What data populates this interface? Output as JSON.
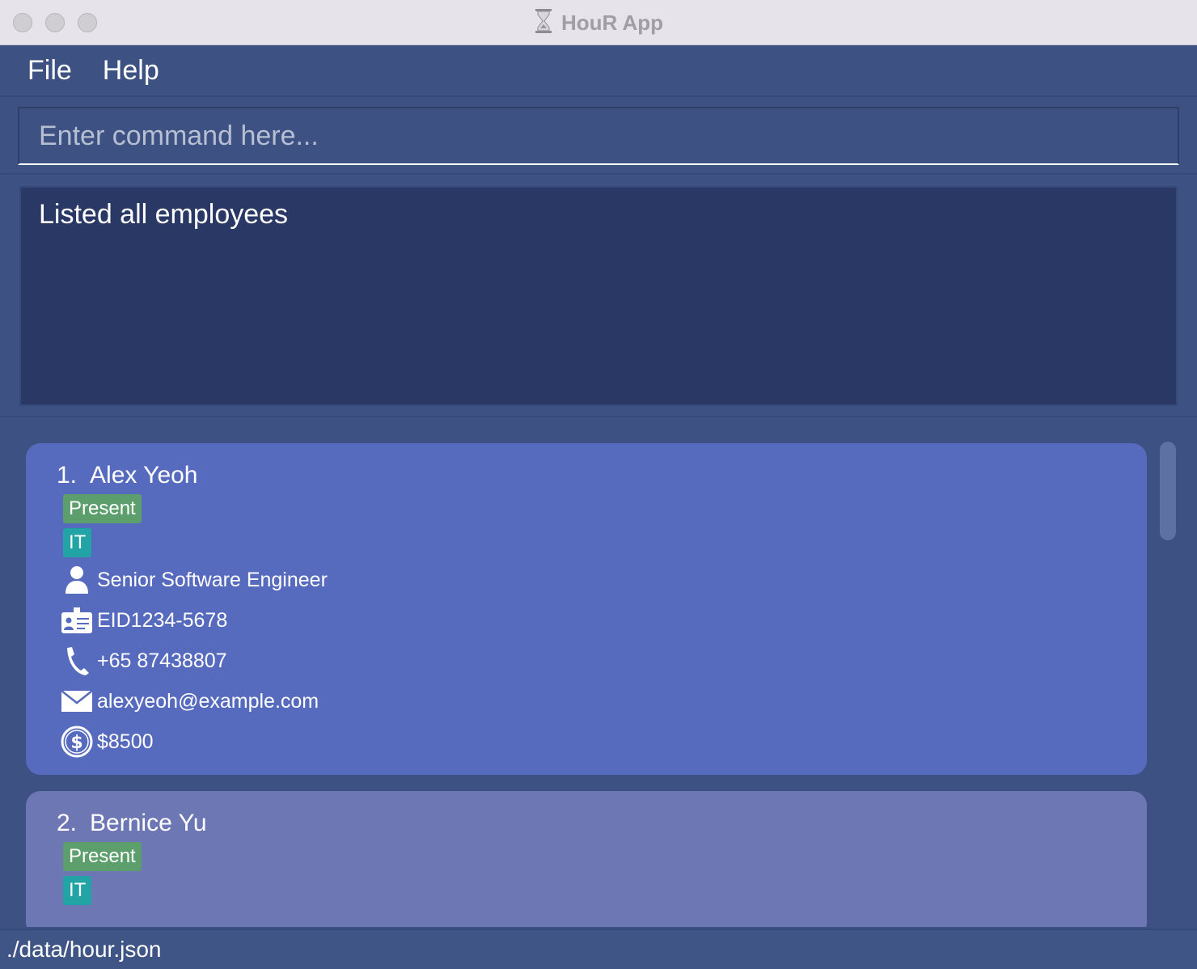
{
  "window": {
    "title": "HouR App"
  },
  "menu": {
    "file_label": "File",
    "help_label": "Help"
  },
  "command": {
    "placeholder": "Enter command here...",
    "value": ""
  },
  "result": {
    "message": "Listed all employees"
  },
  "employees": [
    {
      "index": "1.",
      "name": "Alex Yeoh",
      "status": "Present",
      "department": "IT",
      "position": "Senior Software Engineer",
      "eid": "EID1234-5678",
      "phone": "+65 87438807",
      "email": "alexyeoh@example.com",
      "salary": "$8500"
    },
    {
      "index": "2.",
      "name": "Bernice Yu",
      "status": "Present",
      "department": "IT"
    }
  ],
  "status_bar": {
    "path": "./data/hour.json"
  },
  "colors": {
    "background": "#3d5282",
    "result_bg": "#293865",
    "card_selected": "#566bbe",
    "card_default": "#6d77b3",
    "badge_present": "#5c9f6d",
    "badge_department": "#22a3a6"
  },
  "icons": [
    "hourglass-icon",
    "person-icon",
    "id-card-icon",
    "phone-icon",
    "mail-icon",
    "dollar-icon"
  ]
}
